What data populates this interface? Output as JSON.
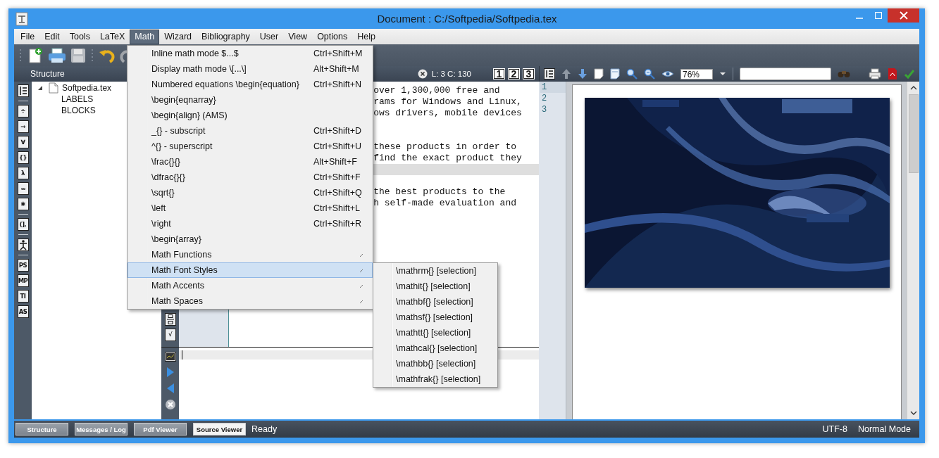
{
  "window": {
    "title": "Document : C:/Softpedia/Softpedia.tex"
  },
  "menu_bar": [
    {
      "label": "File",
      "selected": false
    },
    {
      "label": "Edit",
      "selected": false
    },
    {
      "label": "Tools",
      "selected": false
    },
    {
      "label": "LaTeX",
      "selected": false
    },
    {
      "label": "Math",
      "selected": true
    },
    {
      "label": "Wizard",
      "selected": false
    },
    {
      "label": "Bibliography",
      "selected": false
    },
    {
      "label": "User",
      "selected": false
    },
    {
      "label": "View",
      "selected": false
    },
    {
      "label": "Options",
      "selected": false
    },
    {
      "label": "Help",
      "selected": false
    }
  ],
  "math_menu": [
    {
      "label": "Inline math mode $...$",
      "shortcut": "Ctrl+Shift+M",
      "submenu": false,
      "selected": false
    },
    {
      "label": "Display math mode \\[...\\]",
      "shortcut": "Alt+Shift+M",
      "submenu": false,
      "selected": false
    },
    {
      "label": "Numbered equations \\begin{equation}",
      "shortcut": "Ctrl+Shift+N",
      "submenu": false,
      "selected": false
    },
    {
      "label": "\\begin{eqnarray}",
      "submenu": false,
      "selected": false
    },
    {
      "label": "\\begin{align} (AMS)",
      "submenu": false,
      "selected": false
    },
    {
      "label": "_{} - subscript",
      "shortcut": "Ctrl+Shift+D",
      "submenu": false,
      "selected": false
    },
    {
      "label": "^{} - superscript",
      "shortcut": "Ctrl+Shift+U",
      "submenu": false,
      "selected": false
    },
    {
      "label": "\\frac{}{}",
      "shortcut": "Alt+Shift+F",
      "submenu": false,
      "selected": false
    },
    {
      "label": "\\dfrac{}{}",
      "shortcut": "Ctrl+Shift+F",
      "submenu": false,
      "selected": false
    },
    {
      "label": "\\sqrt{}",
      "shortcut": "Ctrl+Shift+Q",
      "submenu": false,
      "selected": false
    },
    {
      "label": "\\left",
      "shortcut": "Ctrl+Shift+L",
      "submenu": false,
      "selected": false
    },
    {
      "label": "\\right",
      "shortcut": "Ctrl+Shift+R",
      "submenu": false,
      "selected": false
    },
    {
      "label": "\\begin{array}",
      "submenu": false,
      "selected": false
    },
    {
      "label": "Math Functions",
      "submenu": true,
      "selected": false
    },
    {
      "label": "Math Font Styles",
      "submenu": true,
      "selected": true
    },
    {
      "label": "Math Accents",
      "submenu": true,
      "selected": false
    },
    {
      "label": "Math Spaces",
      "submenu": true,
      "selected": false
    }
  ],
  "font_styles_submenu": [
    "\\mathrm{} [selection]",
    "\\mathit{} [selection]",
    "\\mathbf{} [selection]",
    "\\mathsf{} [selection]",
    "\\mathtt{} [selection]",
    "\\mathcal{} [selection]",
    "\\mathbb{} [selection]",
    "\\mathfrak{} [selection]"
  ],
  "structure_panel": {
    "title": "Structure",
    "tree": [
      {
        "label": "Softpedia.tex",
        "expanded": true,
        "children": [
          {
            "label": "LABELS"
          },
          {
            "label": "BLOCKS"
          }
        ]
      }
    ]
  },
  "symbol_strip": [
    {
      "kind": "list"
    },
    {
      "kind": "separator"
    },
    {
      "kind": "glyph",
      "label": "÷"
    },
    {
      "kind": "glyph",
      "label": "⇒"
    },
    {
      "kind": "glyph",
      "label": "∀"
    },
    {
      "kind": "glyph",
      "label": "{}"
    },
    {
      "kind": "glyph",
      "label": "λ"
    },
    {
      "kind": "glyph",
      "label": "∞"
    },
    {
      "kind": "glyph",
      "label": "✱"
    },
    {
      "kind": "separator"
    },
    {
      "kind": "glyph",
      "label": "(]."
    },
    {
      "kind": "separator"
    },
    {
      "kind": "figure"
    },
    {
      "kind": "separator"
    },
    {
      "kind": "glyph",
      "label": "PS"
    },
    {
      "kind": "glyph",
      "label": "MP"
    },
    {
      "kind": "glyph",
      "label": "TI"
    },
    {
      "kind": "glyph",
      "label": "AS"
    }
  ],
  "editor": {
    "position": "L: 3 C: 130",
    "view_buttons": [
      "1",
      "2",
      "3"
    ],
    "lines": [
      {
        "text": "over 1,300,000 free and",
        "current": false
      },
      {
        "text": "rams for Windows and Linux,",
        "current": false
      },
      {
        "text": "ows drivers, mobile devices",
        "current": false
      },
      {
        "current": false
      },
      {
        "current": false
      },
      {
        "text": "these products in order to",
        "current": false
      },
      {
        "text": "find the exact product they",
        "current": false
      },
      {
        "current": true
      },
      {
        "current": false
      },
      {
        "text": "the best products to the",
        "current": false
      },
      {
        "text": "h self-made evaluation and",
        "current": false
      }
    ],
    "strip": [
      {
        "kind": "fraction"
      },
      {
        "kind": "glyph",
        "label": "√"
      }
    ]
  },
  "line_numbers": [
    "1",
    "2",
    "3"
  ],
  "pdf_viewer": {
    "zoom": "76%"
  },
  "status_bar": {
    "tabs": [
      {
        "label": "Structure",
        "selected": false
      },
      {
        "label": "Messages / Log",
        "selected": false
      },
      {
        "label": "Pdf Viewer",
        "selected": false
      },
      {
        "label": "Source Viewer",
        "selected": true
      }
    ],
    "message": "Ready",
    "encoding": "UTF-8",
    "mode": "Normal Mode"
  }
}
